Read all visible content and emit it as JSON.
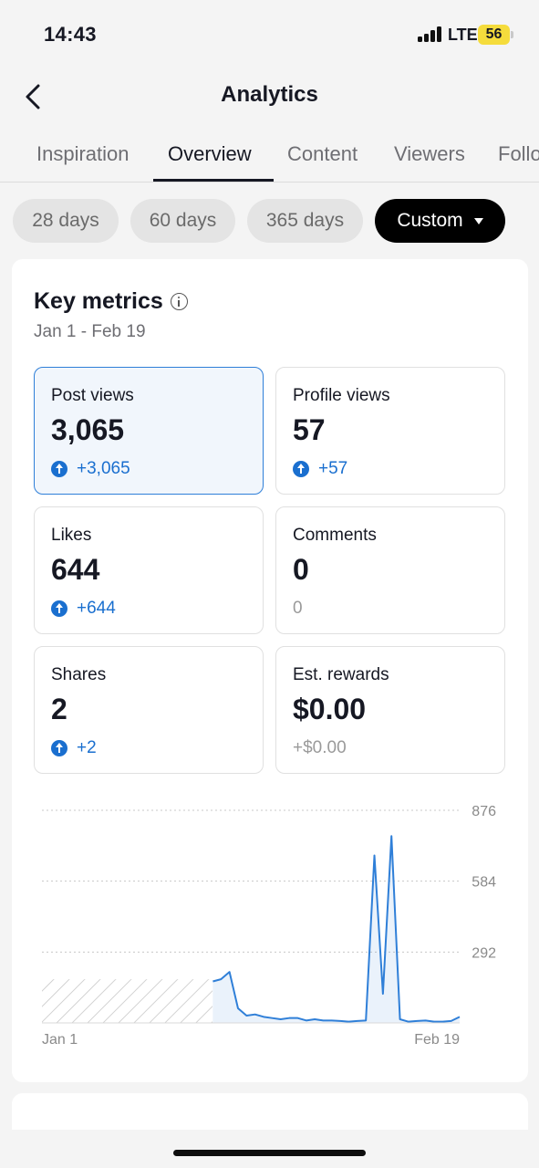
{
  "status_bar": {
    "time": "14:43",
    "network": "LTE",
    "battery": "56"
  },
  "header": {
    "title": "Analytics",
    "back_icon": "chevron-left-icon"
  },
  "tabs": [
    {
      "label": "Inspiration",
      "active": false
    },
    {
      "label": "Overview",
      "active": true
    },
    {
      "label": "Content",
      "active": false
    },
    {
      "label": "Viewers",
      "active": false
    },
    {
      "label": "Followers",
      "active": false
    }
  ],
  "date_ranges": [
    {
      "label": "28 days",
      "active": false
    },
    {
      "label": "60 days",
      "active": false
    },
    {
      "label": "365 days",
      "active": false
    },
    {
      "label": "Custom",
      "active": true
    }
  ],
  "key_metrics": {
    "title": "Key metrics",
    "range": "Jan 1 - Feb 19",
    "metrics": [
      {
        "label": "Post views",
        "value": "3,065",
        "delta": "+3,065",
        "trend": "up",
        "selected": true
      },
      {
        "label": "Profile views",
        "value": "57",
        "delta": "+57",
        "trend": "up",
        "selected": false
      },
      {
        "label": "Likes",
        "value": "644",
        "delta": "+644",
        "trend": "up",
        "selected": false
      },
      {
        "label": "Comments",
        "value": "0",
        "delta": "0",
        "trend": "none",
        "selected": false
      },
      {
        "label": "Shares",
        "value": "2",
        "delta": "+2",
        "trend": "up",
        "selected": false
      },
      {
        "label": "Est. rewards",
        "value": "$0.00",
        "delta": "+$0.00",
        "trend": "none",
        "selected": false
      }
    ]
  },
  "chart_data": {
    "type": "area",
    "title": "",
    "xlabel": "",
    "ylabel": "",
    "x_start_label": "Jan 1",
    "x_end_label": "Feb 19",
    "y_ticks": [
      292,
      584,
      876
    ],
    "ylim": [
      0,
      876
    ],
    "grid": true,
    "color": "#2f7fd8",
    "no_data_days": 21,
    "series": [
      {
        "values": [
          180,
          210,
          60,
          30,
          35,
          25,
          20,
          15,
          20,
          20,
          10,
          15,
          10,
          10,
          8,
          5,
          8,
          10,
          690,
          120,
          770,
          15,
          5,
          8,
          10,
          5,
          5,
          8,
          25
        ]
      }
    ]
  },
  "colors": {
    "accent": "#2f7fd8",
    "delta_up": "#1a6fcf",
    "selected_bg": "#f1f6fc"
  }
}
